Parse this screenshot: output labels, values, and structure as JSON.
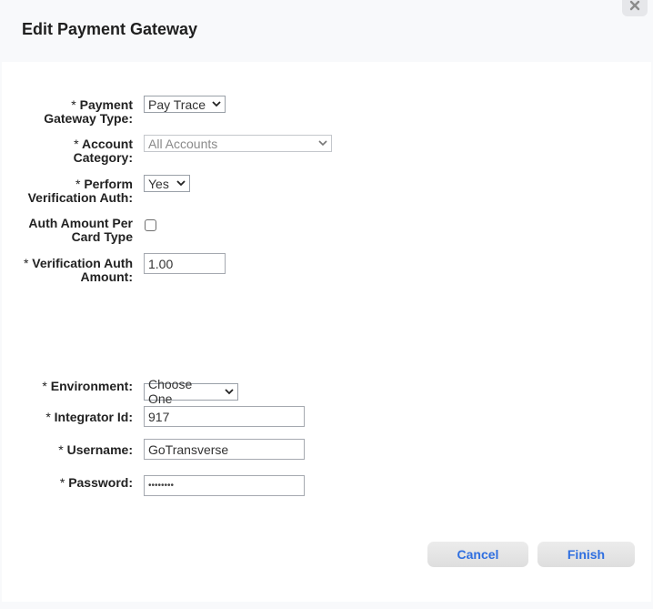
{
  "dialog": {
    "title": "Edit Payment Gateway",
    "close_icon": "close-icon"
  },
  "form": {
    "required_marker": "*",
    "payment_gateway_type": {
      "label_line1": "Payment",
      "label_line2": "Gateway Type:",
      "value": "Pay Trace"
    },
    "account_category": {
      "label_line1": "Account",
      "label_line2": "Category:",
      "value": "All Accounts",
      "disabled": true
    },
    "perform_verification_auth": {
      "label_line1": "Perform",
      "label_line2": "Verification Auth:",
      "value": "Yes"
    },
    "auth_amount_per_card_type": {
      "label_line1": "Auth Amount Per",
      "label_line2": "Card Type",
      "checked": false
    },
    "verification_auth_amount": {
      "label_line1": "Verification Auth",
      "label_line2": "Amount:",
      "value": "1.00"
    },
    "environment": {
      "label": "Environment:",
      "value": "Choose One"
    },
    "integrator_id": {
      "label": "Integrator Id:",
      "value": "917"
    },
    "username": {
      "label": "Username:",
      "value": "GoTransverse"
    },
    "password": {
      "label": "Password:",
      "value": "••••••••"
    }
  },
  "buttons": {
    "cancel": "Cancel",
    "finish": "Finish"
  },
  "colors": {
    "accent": "#2f6fe0",
    "header_bg": "#f8f9fb"
  }
}
